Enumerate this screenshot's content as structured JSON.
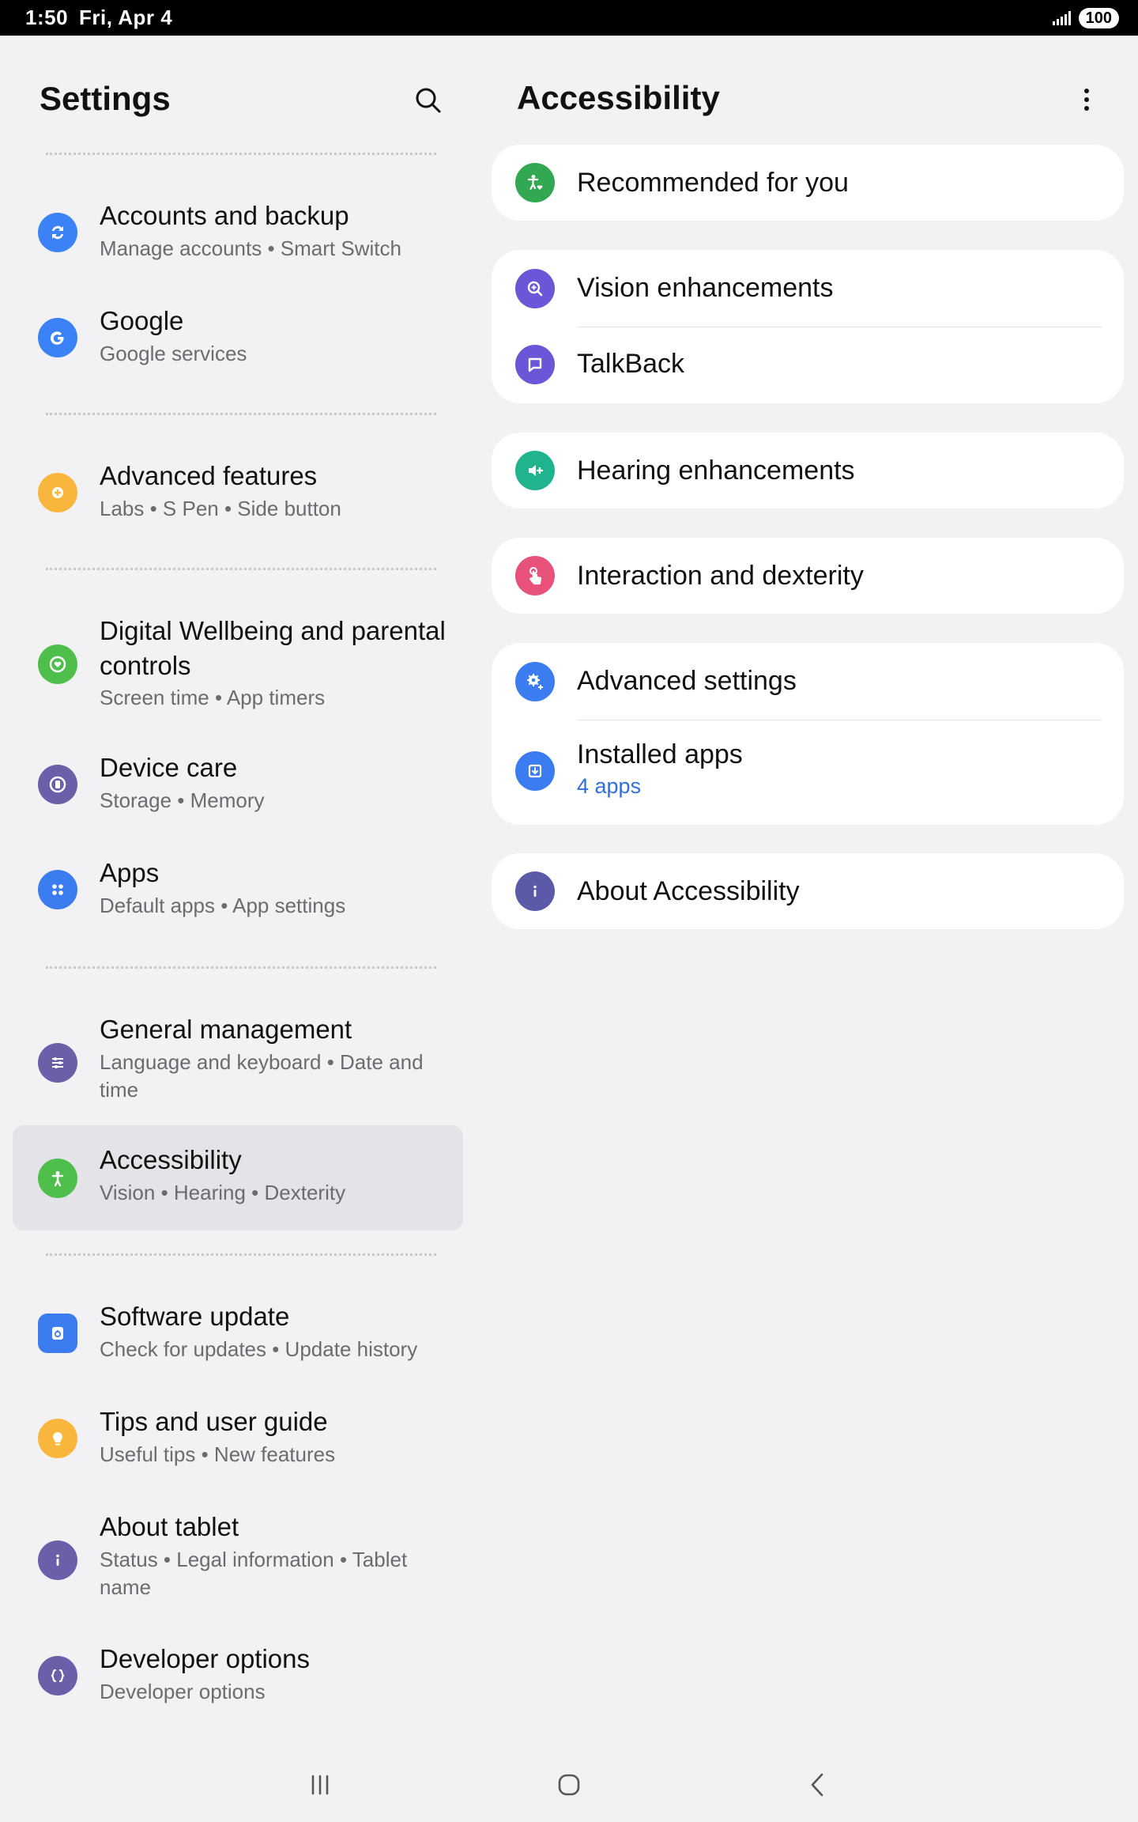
{
  "status_bar": {
    "time": "1:50",
    "date": "Fri, Apr 4",
    "battery": "100"
  },
  "settings": {
    "title": "Settings",
    "items": [
      {
        "title": "Accounts and backup",
        "subtitle": "Manage accounts  •  Smart Switch",
        "icon": "sync-icon",
        "color": "#3b82f6"
      },
      {
        "title": "Google",
        "subtitle": "Google services",
        "icon": "google-icon",
        "color": "#3b82f6"
      },
      {
        "title": "Advanced features",
        "subtitle": "Labs  •  S Pen  •  Side button",
        "icon": "plus-gear-icon",
        "color": "#f8b63d"
      },
      {
        "title": "Digital Wellbeing and parental controls",
        "subtitle": "Screen time  •  App timers",
        "icon": "heart-circle-icon",
        "color": "#4fbf4c"
      },
      {
        "title": "Device care",
        "subtitle": "Storage  •  Memory",
        "icon": "device-care-icon",
        "color": "#6a5fa8"
      },
      {
        "title": "Apps",
        "subtitle": "Default apps  •  App settings",
        "icon": "apps-grid-icon",
        "color": "#3b7cf0"
      },
      {
        "title": "General management",
        "subtitle": "Language and keyboard  •  Date and time",
        "icon": "sliders-icon",
        "color": "#6a5fa8"
      },
      {
        "title": "Accessibility",
        "subtitle": "Vision  •  Hearing  •  Dexterity",
        "icon": "accessibility-icon",
        "color": "#4fbf4c"
      },
      {
        "title": "Software update",
        "subtitle": "Check for updates  •  Update history",
        "icon": "software-update-icon",
        "color": "#3b7cf0"
      },
      {
        "title": "Tips and user guide",
        "subtitle": "Useful tips  •  New features",
        "icon": "lightbulb-icon",
        "color": "#f8b63d"
      },
      {
        "title": "About tablet",
        "subtitle": "Status  •  Legal information  •  Tablet name",
        "icon": "info-icon",
        "color": "#6a5fa8"
      },
      {
        "title": "Developer options",
        "subtitle": "Developer options",
        "icon": "braces-icon",
        "color": "#6a5fa8"
      }
    ]
  },
  "accessibility": {
    "title": "Accessibility",
    "recommended": "Recommended for you",
    "vision": "Vision enhancements",
    "talkback": "TalkBack",
    "hearing": "Hearing enhancements",
    "interaction": "Interaction and dexterity",
    "advanced": "Advanced settings",
    "installed_apps": "Installed apps",
    "installed_apps_count": "4 apps",
    "about": "About Accessibility"
  },
  "colors": {
    "green": "#33a852",
    "purple": "#6a57d8",
    "teal": "#1fb48e",
    "pink": "#e8527a",
    "blue": "#3b7cf0",
    "indigo": "#5b5aa8",
    "link": "#2f6fe0"
  }
}
